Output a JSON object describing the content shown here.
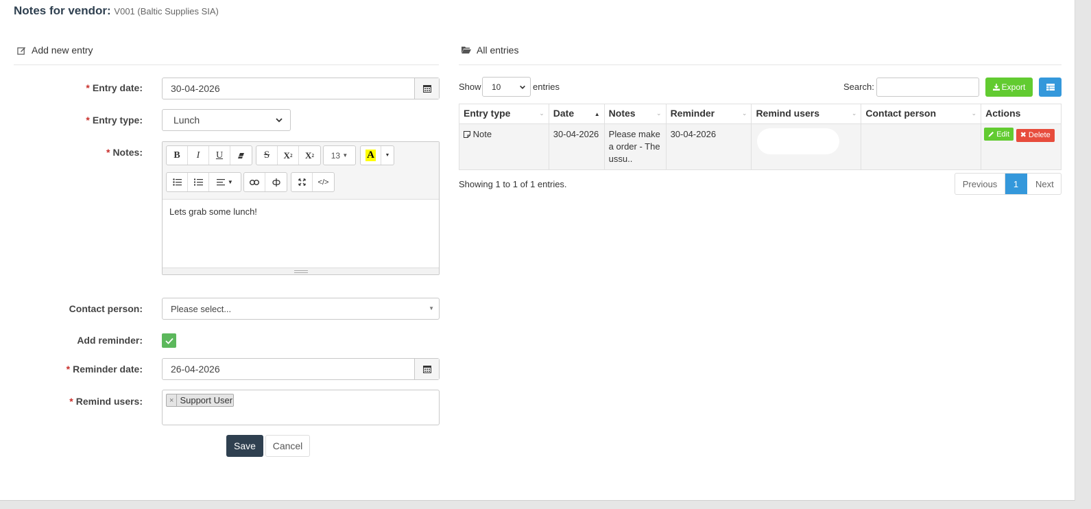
{
  "header": {
    "title": "Notes for vendor:",
    "subtitle": "V001 (Baltic Supplies SIA)"
  },
  "form": {
    "section_title": "Add new entry",
    "entry_date": {
      "label": "Entry date:",
      "value": "30-04-2026"
    },
    "entry_type": {
      "label": "Entry type:",
      "value": "Lunch"
    },
    "notes": {
      "label": "Notes:",
      "font_size": "13",
      "content": "Lets grab some lunch!"
    },
    "contact_person": {
      "label": "Contact person:",
      "placeholder": "Please select..."
    },
    "add_reminder": {
      "label": "Add reminder:",
      "checked": true
    },
    "reminder_date": {
      "label": "Reminder date:",
      "value": "26-04-2026"
    },
    "remind_users": {
      "label": "Remind users:",
      "tags": [
        "Support User"
      ]
    },
    "save_label": "Save",
    "cancel_label": "Cancel",
    "required_mark": "*"
  },
  "list": {
    "section_title": "All entries",
    "show_label": "Show",
    "page_size": "10",
    "entries_label": "entries",
    "search_label": "Search:",
    "export_label": "Export",
    "columns": [
      "Entry type",
      "Date",
      "Notes",
      "Reminder",
      "Remind users",
      "Contact person",
      "Actions"
    ],
    "rows": [
      {
        "entry_type": "Note",
        "date": "30-04-2026",
        "notes": "Please make a order - The ussu..",
        "reminder": "30-04-2026",
        "remind_users": "",
        "contact_person": "",
        "edit_label": "Edit",
        "delete_label": "Delete"
      }
    ],
    "info": "Showing 1 to 1 of 1 entries.",
    "pagination": {
      "previous": "Previous",
      "current": "1",
      "next": "Next"
    }
  },
  "colors": {
    "primary": "#2f4050",
    "success": "#5cb85c",
    "export": "#62cb31",
    "info": "#3498db",
    "danger": "#e74c3c",
    "required": "#c9302c"
  }
}
